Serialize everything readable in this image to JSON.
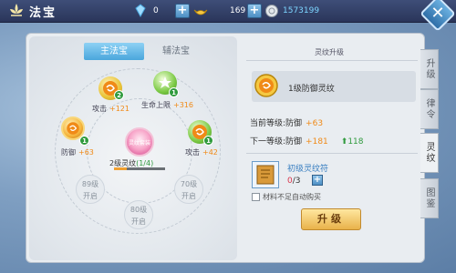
{
  "header": {
    "title": "法宝",
    "diamond_value": "0",
    "gold_value": "169",
    "silver_value": "1573199"
  },
  "tabs": {
    "main": "主法宝",
    "sub": "辅法宝"
  },
  "nodes": [
    {
      "label": "攻击",
      "value": "+121",
      "level": "2"
    },
    {
      "label": "生命上限",
      "value": "+316",
      "level": "1"
    },
    {
      "label": "防御",
      "value": "+63",
      "level": "1"
    },
    {
      "label": "攻击",
      "value": "+42",
      "level": "1"
    }
  ],
  "locked_nodes": [
    {
      "level": "89级",
      "text": "开启"
    },
    {
      "level": "70级",
      "text": "开启"
    },
    {
      "level": "80级",
      "text": "开启"
    }
  ],
  "center": {
    "orb_text": "灵纹套装",
    "label": "2级灵纹",
    "progress_text": "(1/4)",
    "progress": 0.25
  },
  "details": {
    "section_title": "灵纹升级",
    "rune_name": "1级防御灵纹",
    "current_label": "当前等级:防御",
    "current_value": "+63",
    "next_label": "下一等级:防御",
    "next_value": "+181",
    "increase": "118",
    "item_name": "初级灵纹符",
    "item_have": "0",
    "item_need": "/3",
    "auto_buy_label": "材料不足自动购买",
    "upgrade_label": "升级"
  },
  "side_tabs": [
    "升级",
    "律令",
    "灵纹",
    "图鉴"
  ],
  "active_side_tab": 2
}
